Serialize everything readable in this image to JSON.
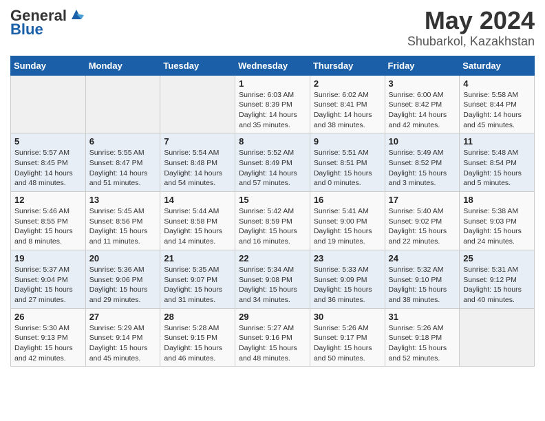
{
  "header": {
    "logo": {
      "general": "General",
      "blue": "Blue"
    },
    "title": "May 2024",
    "subtitle": "Shubarkol, Kazakhstan"
  },
  "weekdays": [
    "Sunday",
    "Monday",
    "Tuesday",
    "Wednesday",
    "Thursday",
    "Friday",
    "Saturday"
  ],
  "weeks": [
    [
      {
        "day": "",
        "sunrise": "",
        "sunset": "",
        "daylight": ""
      },
      {
        "day": "",
        "sunrise": "",
        "sunset": "",
        "daylight": ""
      },
      {
        "day": "",
        "sunrise": "",
        "sunset": "",
        "daylight": ""
      },
      {
        "day": "1",
        "sunrise": "Sunrise: 6:03 AM",
        "sunset": "Sunset: 8:39 PM",
        "daylight": "Daylight: 14 hours and 35 minutes."
      },
      {
        "day": "2",
        "sunrise": "Sunrise: 6:02 AM",
        "sunset": "Sunset: 8:41 PM",
        "daylight": "Daylight: 14 hours and 38 minutes."
      },
      {
        "day": "3",
        "sunrise": "Sunrise: 6:00 AM",
        "sunset": "Sunset: 8:42 PM",
        "daylight": "Daylight: 14 hours and 42 minutes."
      },
      {
        "day": "4",
        "sunrise": "Sunrise: 5:58 AM",
        "sunset": "Sunset: 8:44 PM",
        "daylight": "Daylight: 14 hours and 45 minutes."
      }
    ],
    [
      {
        "day": "5",
        "sunrise": "Sunrise: 5:57 AM",
        "sunset": "Sunset: 8:45 PM",
        "daylight": "Daylight: 14 hours and 48 minutes."
      },
      {
        "day": "6",
        "sunrise": "Sunrise: 5:55 AM",
        "sunset": "Sunset: 8:47 PM",
        "daylight": "Daylight: 14 hours and 51 minutes."
      },
      {
        "day": "7",
        "sunrise": "Sunrise: 5:54 AM",
        "sunset": "Sunset: 8:48 PM",
        "daylight": "Daylight: 14 hours and 54 minutes."
      },
      {
        "day": "8",
        "sunrise": "Sunrise: 5:52 AM",
        "sunset": "Sunset: 8:49 PM",
        "daylight": "Daylight: 14 hours and 57 minutes."
      },
      {
        "day": "9",
        "sunrise": "Sunrise: 5:51 AM",
        "sunset": "Sunset: 8:51 PM",
        "daylight": "Daylight: 15 hours and 0 minutes."
      },
      {
        "day": "10",
        "sunrise": "Sunrise: 5:49 AM",
        "sunset": "Sunset: 8:52 PM",
        "daylight": "Daylight: 15 hours and 3 minutes."
      },
      {
        "day": "11",
        "sunrise": "Sunrise: 5:48 AM",
        "sunset": "Sunset: 8:54 PM",
        "daylight": "Daylight: 15 hours and 5 minutes."
      }
    ],
    [
      {
        "day": "12",
        "sunrise": "Sunrise: 5:46 AM",
        "sunset": "Sunset: 8:55 PM",
        "daylight": "Daylight: 15 hours and 8 minutes."
      },
      {
        "day": "13",
        "sunrise": "Sunrise: 5:45 AM",
        "sunset": "Sunset: 8:56 PM",
        "daylight": "Daylight: 15 hours and 11 minutes."
      },
      {
        "day": "14",
        "sunrise": "Sunrise: 5:44 AM",
        "sunset": "Sunset: 8:58 PM",
        "daylight": "Daylight: 15 hours and 14 minutes."
      },
      {
        "day": "15",
        "sunrise": "Sunrise: 5:42 AM",
        "sunset": "Sunset: 8:59 PM",
        "daylight": "Daylight: 15 hours and 16 minutes."
      },
      {
        "day": "16",
        "sunrise": "Sunrise: 5:41 AM",
        "sunset": "Sunset: 9:00 PM",
        "daylight": "Daylight: 15 hours and 19 minutes."
      },
      {
        "day": "17",
        "sunrise": "Sunrise: 5:40 AM",
        "sunset": "Sunset: 9:02 PM",
        "daylight": "Daylight: 15 hours and 22 minutes."
      },
      {
        "day": "18",
        "sunrise": "Sunrise: 5:38 AM",
        "sunset": "Sunset: 9:03 PM",
        "daylight": "Daylight: 15 hours and 24 minutes."
      }
    ],
    [
      {
        "day": "19",
        "sunrise": "Sunrise: 5:37 AM",
        "sunset": "Sunset: 9:04 PM",
        "daylight": "Daylight: 15 hours and 27 minutes."
      },
      {
        "day": "20",
        "sunrise": "Sunrise: 5:36 AM",
        "sunset": "Sunset: 9:06 PM",
        "daylight": "Daylight: 15 hours and 29 minutes."
      },
      {
        "day": "21",
        "sunrise": "Sunrise: 5:35 AM",
        "sunset": "Sunset: 9:07 PM",
        "daylight": "Daylight: 15 hours and 31 minutes."
      },
      {
        "day": "22",
        "sunrise": "Sunrise: 5:34 AM",
        "sunset": "Sunset: 9:08 PM",
        "daylight": "Daylight: 15 hours and 34 minutes."
      },
      {
        "day": "23",
        "sunrise": "Sunrise: 5:33 AM",
        "sunset": "Sunset: 9:09 PM",
        "daylight": "Daylight: 15 hours and 36 minutes."
      },
      {
        "day": "24",
        "sunrise": "Sunrise: 5:32 AM",
        "sunset": "Sunset: 9:10 PM",
        "daylight": "Daylight: 15 hours and 38 minutes."
      },
      {
        "day": "25",
        "sunrise": "Sunrise: 5:31 AM",
        "sunset": "Sunset: 9:12 PM",
        "daylight": "Daylight: 15 hours and 40 minutes."
      }
    ],
    [
      {
        "day": "26",
        "sunrise": "Sunrise: 5:30 AM",
        "sunset": "Sunset: 9:13 PM",
        "daylight": "Daylight: 15 hours and 42 minutes."
      },
      {
        "day": "27",
        "sunrise": "Sunrise: 5:29 AM",
        "sunset": "Sunset: 9:14 PM",
        "daylight": "Daylight: 15 hours and 45 minutes."
      },
      {
        "day": "28",
        "sunrise": "Sunrise: 5:28 AM",
        "sunset": "Sunset: 9:15 PM",
        "daylight": "Daylight: 15 hours and 46 minutes."
      },
      {
        "day": "29",
        "sunrise": "Sunrise: 5:27 AM",
        "sunset": "Sunset: 9:16 PM",
        "daylight": "Daylight: 15 hours and 48 minutes."
      },
      {
        "day": "30",
        "sunrise": "Sunrise: 5:26 AM",
        "sunset": "Sunset: 9:17 PM",
        "daylight": "Daylight: 15 hours and 50 minutes."
      },
      {
        "day": "31",
        "sunrise": "Sunrise: 5:26 AM",
        "sunset": "Sunset: 9:18 PM",
        "daylight": "Daylight: 15 hours and 52 minutes."
      },
      {
        "day": "",
        "sunrise": "",
        "sunset": "",
        "daylight": ""
      }
    ]
  ]
}
